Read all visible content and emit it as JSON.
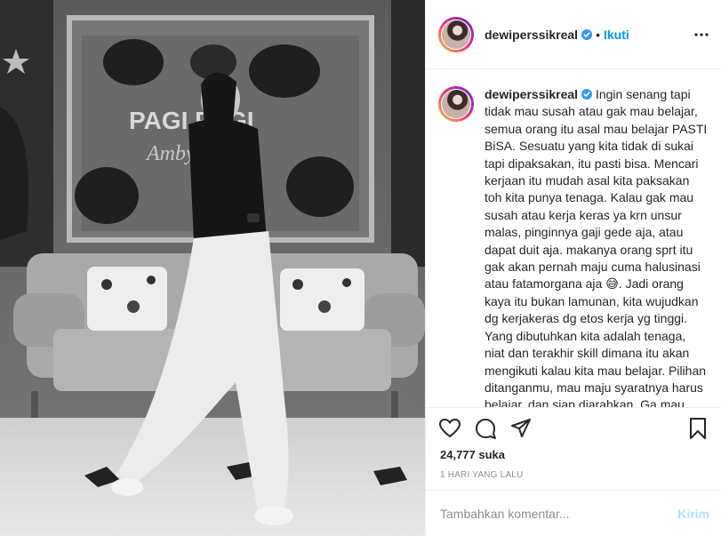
{
  "post": {
    "username": "dewiperssikreal",
    "follow_label": "Ikuti",
    "dot": "•",
    "photo_sign_line1": "PAGI PAGI",
    "photo_sign_line2": "Ambyarrr"
  },
  "caption": {
    "username": "dewiperssikreal",
    "text": "Ingin senang tapi tidak mau susah atau gak mau belajar, semua orang itu asal mau belajar PASTI BiSA. Sesuatu yang kita tidak di sukai tapi dipaksakan, itu pasti bisa. Mencari kerjaan itu mudah asal kita paksakan toh kita punya tenaga. Kalau gak mau susah atau kerja keras ya krn unsur malas, pinginnya gaji gede aja, atau dapat duit aja. makanya orang sprt itu gak akan pernah maju cuma halusinasi atau fatamorgana aja 😅. Jadi orang kaya itu bukan lamunan, kita wujudkan dg kerjakeras dg etos kerja yg tinggi. Yang dibutuhkan kita adalah tenaga, niat dan terakhir skill dimana itu akan mengikuti kalau kita mau belajar. Pilihan ditanganmu, mau maju syaratnya harus belajar, dan siap diarahkan. Ga mau maju ya pulang"
  },
  "stats": {
    "likes": "24,777 suka",
    "time": "1 HARI YANG LALU"
  },
  "comment": {
    "placeholder": "Tambahkan komentar...",
    "post_label": "Kirim"
  },
  "icons": {
    "like": "heart-icon",
    "comment": "comment-icon",
    "share": "share-icon",
    "save": "bookmark-icon",
    "more": "more-icon",
    "verified": "verified-badge-icon"
  },
  "colors": {
    "accent": "#0095f6",
    "post_disabled": "#b2dffc",
    "muted": "#8e8e8e",
    "text": "#262626"
  }
}
